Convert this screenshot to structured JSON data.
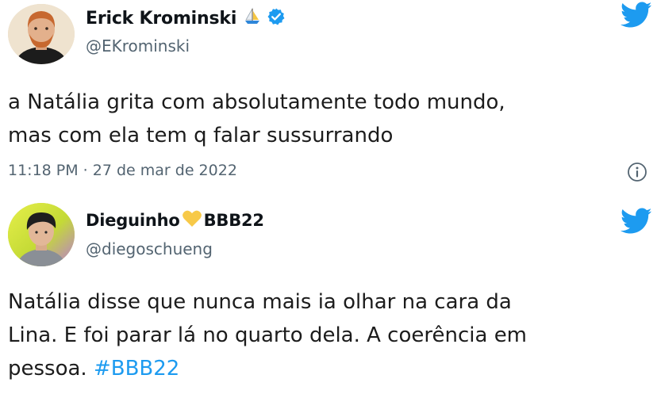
{
  "tweets": [
    {
      "author": {
        "display_name": "Erick Krominski",
        "handle": "@EKrominski",
        "badge_emoji": "sailboat-icon",
        "verified": true
      },
      "text_lines": [
        "a Natália grita com absolutamente todo mundo,",
        "mas com ela tem q falar sussurrando"
      ],
      "timestamp": "11:18 PM · 27 de mar de 2022"
    },
    {
      "author": {
        "display_name_prefix": "Dieguinho",
        "display_name_suffix": "BBB22",
        "handle": "@diegoschueng",
        "badge_emoji": "yellow-heart-icon"
      },
      "text_lines": [
        "Natália disse que nunca mais ia olhar na cara da",
        "Lina. E foi parar lá no quarto dela. A coerência em",
        "pessoa. "
      ],
      "hashtag": "#BBB22"
    }
  ],
  "colors": {
    "twitter_blue": "#1d9bf0",
    "secondary_text": "#536471",
    "primary_text": "#0f1419",
    "heart": "#f7c948"
  }
}
